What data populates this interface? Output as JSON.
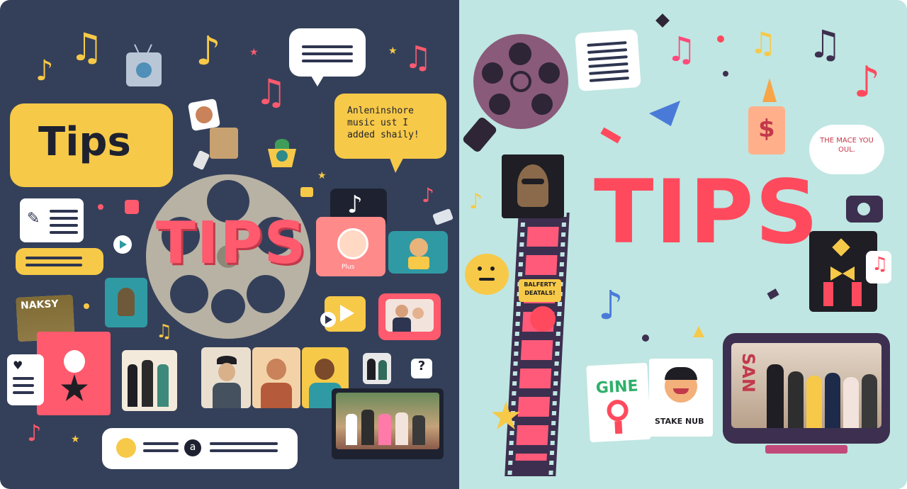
{
  "left": {
    "tips_badge_label": "Tips",
    "reel_title": "TIPS",
    "speech_text": "Anleninshore music ust I added shaily!",
    "poster_label": "NAKSY",
    "photo_card_caption": "Plus",
    "help_glyph": "?",
    "bottom_bar_glyph": "a",
    "colors": {
      "background": "#34405a",
      "accent_yellow": "#f7c948",
      "accent_red": "#ff5a6e"
    }
  },
  "right": {
    "title": "TIPS",
    "bubble_text": "THE MACE YOU OUL.",
    "price_glyph": "$",
    "filmstrip_sign": "BALFERTY DEATALS!",
    "card1_label": "GINE",
    "card2_label": "STAKE NUB",
    "tv_sign": "SAN",
    "colors": {
      "background": "#bfe6e2",
      "accent_red": "#ff4a5e",
      "accent_purple": "#3d2f4f"
    }
  },
  "icons": [
    "music-note-icon",
    "tv-icon",
    "film-reel-icon",
    "chat-bubble-icon",
    "camera-icon",
    "play-icon",
    "star-icon",
    "dollar-icon",
    "question-icon"
  ]
}
